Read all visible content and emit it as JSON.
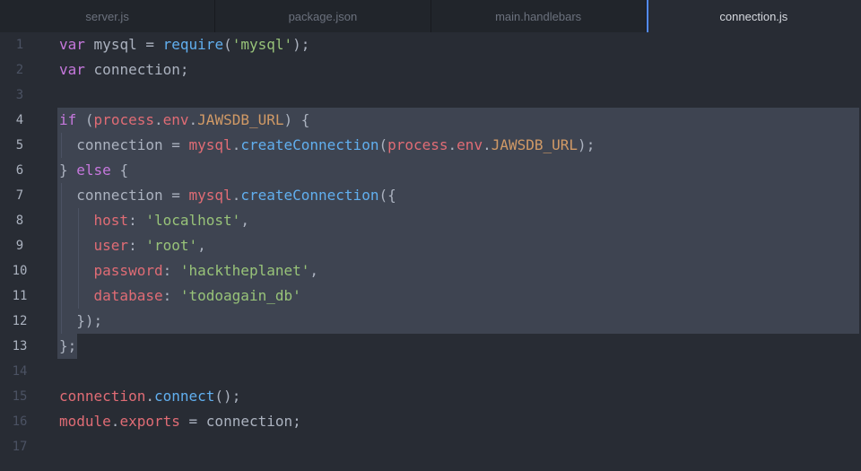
{
  "tabs": [
    {
      "label": "server.js",
      "active": false
    },
    {
      "label": "package.json",
      "active": false
    },
    {
      "label": "main.handlebars",
      "active": false
    },
    {
      "label": "connection.js",
      "active": true
    }
  ],
  "editor": {
    "line_numbers": [
      "1",
      "2",
      "3",
      "4",
      "5",
      "6",
      "7",
      "8",
      "9",
      "10",
      "11",
      "12",
      "13",
      "14",
      "15",
      "16",
      "17"
    ],
    "lines": [
      "var mysql = require('mysql');",
      "var connection;",
      "",
      "if (process.env.JAWSDB_URL) {",
      "  connection = mysql.createConnection(process.env.JAWSDB_URL);",
      "} else {",
      "  connection = mysql.createConnection({",
      "    host: 'localhost',",
      "    user: 'root',",
      "    password: 'hacktheplanet',",
      "    database: 'todoagain_db'",
      "  });",
      "};",
      "",
      "connection.connect();",
      "module.exports = connection;",
      ""
    ],
    "selected_lines": [
      "4",
      "5",
      "6",
      "7",
      "8",
      "9",
      "10",
      "11",
      "12",
      "13"
    ]
  },
  "colors": {
    "background": "#282c34",
    "tabbar": "#21252b",
    "selection": "#3e4451",
    "keyword": "#c678dd",
    "function": "#61afef",
    "string": "#98c379",
    "variable": "#e06c75",
    "property": "#d19a66",
    "accent": "#528bff"
  }
}
